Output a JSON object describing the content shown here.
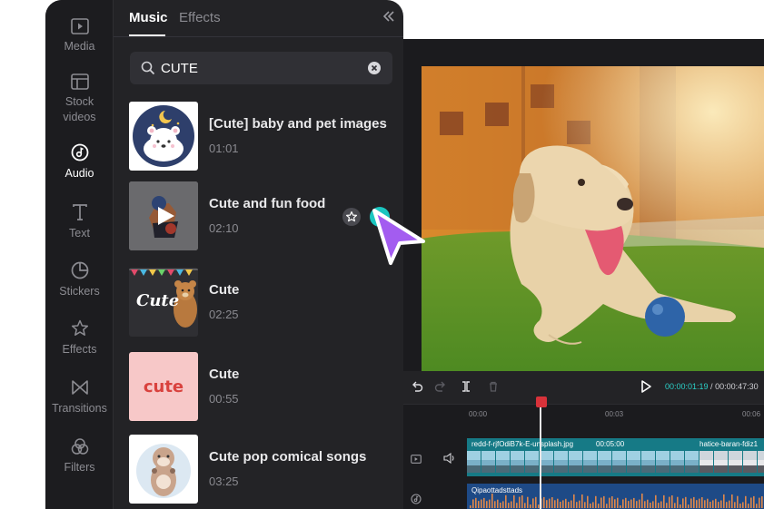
{
  "sidebar": {
    "items": [
      {
        "label": "Media",
        "icon": "media-icon"
      },
      {
        "label": "Stock videos",
        "icon": "stock-videos-icon"
      },
      {
        "label": "Audio",
        "icon": "audio-icon",
        "active": true
      },
      {
        "label": "Text",
        "icon": "text-icon"
      },
      {
        "label": "Stickers",
        "icon": "stickers-icon"
      },
      {
        "label": "Effects",
        "icon": "effects-icon"
      },
      {
        "label": "Transitions",
        "icon": "transitions-icon"
      },
      {
        "label": "Filters",
        "icon": "filters-icon"
      }
    ]
  },
  "tabs": [
    {
      "label": "Music",
      "active": true
    },
    {
      "label": "Effects",
      "active": false
    }
  ],
  "search": {
    "value": "CUTE"
  },
  "tracks": [
    {
      "title": "[Cute] baby and pet images",
      "duration": "01:01"
    },
    {
      "title": "Cute and fun food",
      "duration": "02:10"
    },
    {
      "title": "Cute",
      "duration": "02:25"
    },
    {
      "title": "Cute",
      "duration": "00:55"
    },
    {
      "title": "Cute pop comical songs",
      "duration": "03:25"
    }
  ],
  "thumbnails": {
    "cute_text": "Cute",
    "cute_pink_text": "cute"
  },
  "player": {
    "current_time": "00:00:01:19",
    "separator": " / ",
    "total_time": "00:00:47:30"
  },
  "timeline": {
    "ticks": [
      "00:00",
      "00:03",
      "00:06"
    ],
    "video_clip_name": "redd-f-rjfOdiB7k-E-unsplash.jpg",
    "video_clip_duration": "00:05:00",
    "video_clip_next": "hatice-baran-fdiz1",
    "audio_clip_name": "Qipaottadsttads"
  },
  "colors": {
    "accent": "#1bc6c0",
    "time_accent": "#2bd0c8",
    "cursor": "#a35cf0",
    "playhead": "#d8323a",
    "video_clip": "#167a86",
    "audio_clip": "#1e4a86"
  }
}
